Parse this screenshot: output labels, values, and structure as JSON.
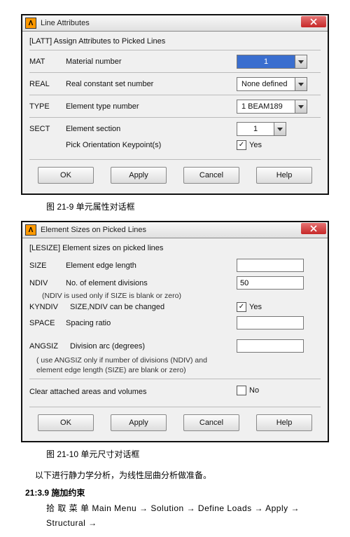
{
  "dlg1": {
    "title": "Line Attributes",
    "header": "[LATT]   Assign Attributes to Picked Lines",
    "rows": {
      "mat": {
        "code": "MAT",
        "desc": "Material number",
        "val": "1"
      },
      "real": {
        "code": "REAL",
        "desc": "Real constant set number",
        "val": "None defined"
      },
      "type": {
        "code": "TYPE",
        "desc": "Element type number",
        "val": "1   BEAM189"
      },
      "sect": {
        "code": "SECT",
        "desc": "Element section",
        "val": "1"
      },
      "pick": {
        "desc": "Pick Orientation Keypoint(s)",
        "chk": "Yes"
      }
    },
    "buttons": {
      "ok": "OK",
      "apply": "Apply",
      "cancel": "Cancel",
      "help": "Help"
    }
  },
  "cap1": "图 21-9 单元属性对话框",
  "dlg2": {
    "title": "Element Sizes on Picked Lines",
    "header": "[LESIZE]  Element sizes on picked lines",
    "size": {
      "code": "SIZE",
      "desc": "Element edge length",
      "val": ""
    },
    "ndiv": {
      "code": "NDIV",
      "desc": "No. of element divisions",
      "val": "50"
    },
    "ndivnote": "(NDIV is used only if SIZE is blank or zero)",
    "kyndiv": {
      "code": "KYNDIV",
      "desc": "SIZE,NDIV can be changed",
      "chk": "Yes"
    },
    "space": {
      "code": "SPACE",
      "desc": "Spacing ratio",
      "val": ""
    },
    "angsiz": {
      "code": "ANGSIZ",
      "desc": "Division arc (degrees)",
      "val": ""
    },
    "angnote1": "( use ANGSIZ only if number of divisions (NDIV) and",
    "angnote2": "element edge length (SIZE) are blank or zero)",
    "clear": {
      "desc": "Clear attached areas and volumes",
      "chk": "No"
    },
    "buttons": {
      "ok": "OK",
      "apply": "Apply",
      "cancel": "Cancel",
      "help": "Help"
    }
  },
  "cap2": "图 21-10 单元尺寸对话框",
  "line1": "以下进行静力学分析，为线性屈曲分析做准备。",
  "sec": "21:3.9 施加约束",
  "menuline": "拾 取 菜 单  Main  Menu → Solution → Define  Loads → Apply → Structural →"
}
